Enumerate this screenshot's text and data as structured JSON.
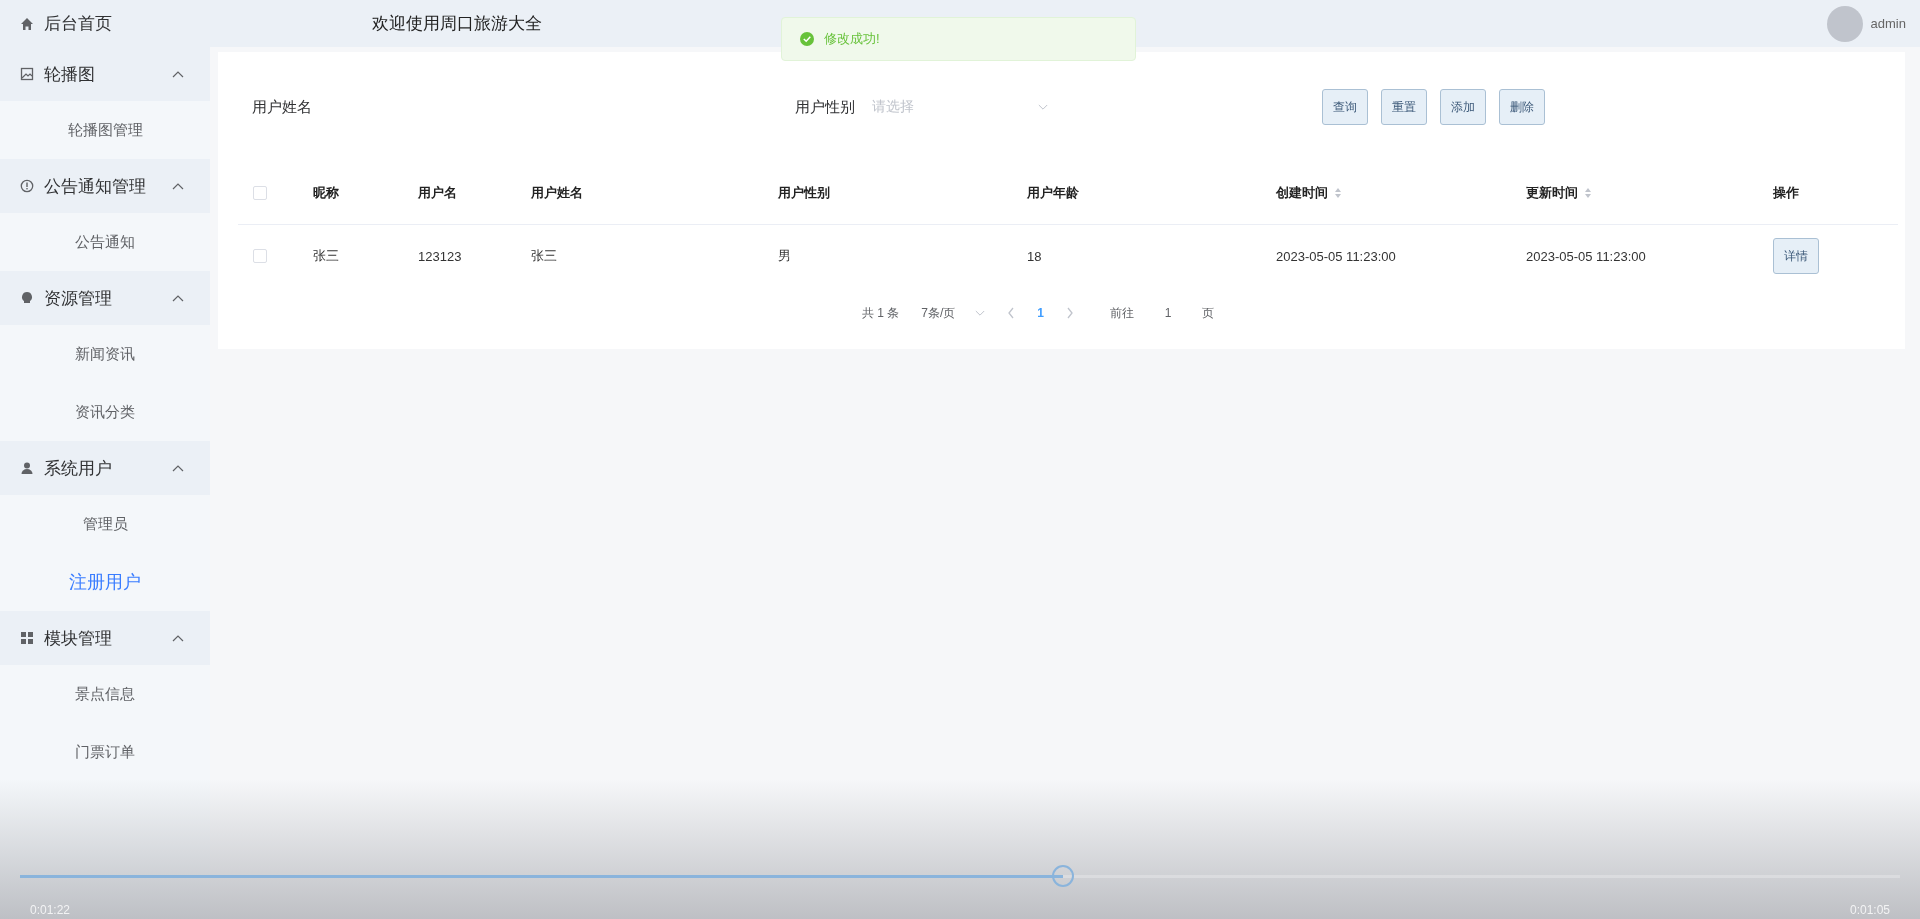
{
  "sidebar": {
    "home": {
      "label": "后台首页",
      "selected": false
    },
    "groups": [
      {
        "label": "轮播图",
        "kind": "image",
        "expanded": true,
        "items": [
          {
            "label": "轮播图管理",
            "selected": false
          }
        ]
      },
      {
        "label": "公告通知管理",
        "kind": "notice",
        "expanded": true,
        "items": [
          {
            "label": "公告通知",
            "selected": false
          }
        ]
      },
      {
        "label": "资源管理",
        "kind": "bulb",
        "expanded": true,
        "items": [
          {
            "label": "新闻资讯",
            "selected": false
          },
          {
            "label": "资讯分类",
            "selected": false
          }
        ]
      },
      {
        "label": "系统用户",
        "kind": "user",
        "expanded": true,
        "items": [
          {
            "label": "管理员",
            "selected": false
          },
          {
            "label": "注册用户",
            "selected": true
          }
        ]
      },
      {
        "label": "模块管理",
        "kind": "grid",
        "expanded": true,
        "items": [
          {
            "label": "景点信息",
            "selected": false
          },
          {
            "label": "门票订单",
            "selected": false
          }
        ]
      }
    ]
  },
  "header": {
    "title": "欢迎使用周口旅游大全",
    "user": "admin"
  },
  "toast": {
    "kind": "success",
    "text": "修改成功!"
  },
  "search": {
    "fields": [
      {
        "kind": "text",
        "label": "用户姓名"
      },
      {
        "kind": "select",
        "label": "用户性别",
        "placeholder": "请选择"
      }
    ],
    "buttons": [
      "查询",
      "重置",
      "添加",
      "删除"
    ]
  },
  "table": {
    "select_all": false,
    "columns": [
      {
        "label": "昵称",
        "sortable": false
      },
      {
        "label": "用户名",
        "sortable": false
      },
      {
        "label": "用户姓名",
        "sortable": false
      },
      {
        "label": "用户性别",
        "sortable": false
      },
      {
        "label": "用户年龄",
        "sortable": false
      },
      {
        "label": "创建时间",
        "sortable": true
      },
      {
        "label": "更新时间",
        "sortable": true
      },
      {
        "label": "操作",
        "sortable": false
      }
    ],
    "rows": [
      {
        "checked": false,
        "cells": [
          "张三",
          "123123",
          "张三",
          "男",
          "18",
          "2023-05-05 11:23:00",
          "2023-05-05 11:23:00"
        ],
        "action": "详情"
      }
    ]
  },
  "pagination": {
    "total": "共 1 条",
    "page_size": "7条/页",
    "pages": [
      {
        "label": "1",
        "selected": true
      }
    ],
    "goto_label": "前往",
    "goto_value": "1",
    "goto_suffix": "页"
  },
  "video": {
    "level": 0.555,
    "elapsed": "0:01:22",
    "remaining": "0:01:05"
  }
}
